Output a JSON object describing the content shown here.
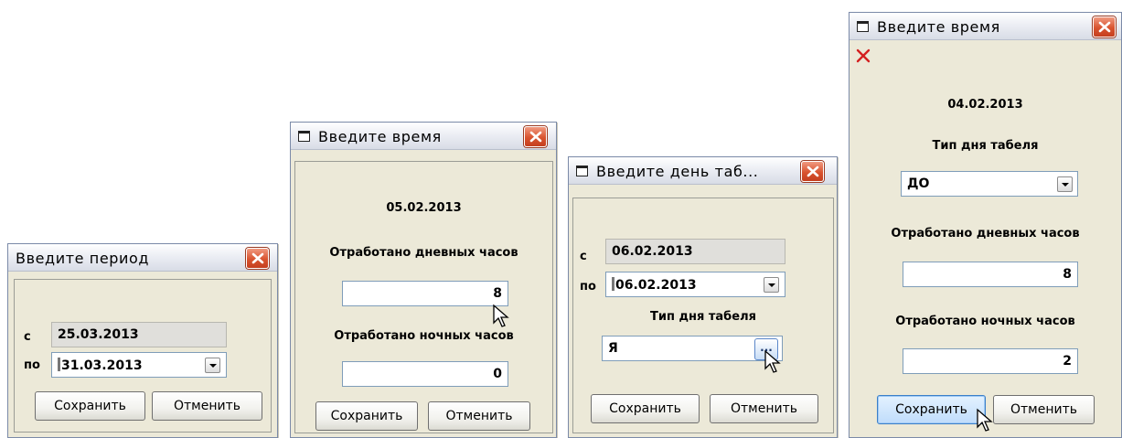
{
  "dialogs": [
    {
      "title": "Введите период",
      "from_label": "с",
      "from_value": "25.03.2013",
      "to_label": "по",
      "to_value": "31.03.2013",
      "save_label": "Сохранить",
      "cancel_label": "Отменить"
    },
    {
      "title": "Введите время",
      "date": "05.02.2013",
      "day_hours_label": "Отработано дневных часов",
      "day_hours_value": "8",
      "night_hours_label": "Отработано ночных часов",
      "night_hours_value": "0",
      "save_label": "Сохранить",
      "cancel_label": "Отменить"
    },
    {
      "title": "Введите день таб...",
      "from_label": "с",
      "from_value": "06.02.2013",
      "to_label": "по",
      "to_value": "06.02.2013",
      "day_type_label": "Тип дня табеля",
      "day_type_value": "Я",
      "ellipsis_label": "...",
      "save_label": "Сохранить",
      "cancel_label": "Отменить"
    },
    {
      "title": "Введите время",
      "date": "04.02.2013",
      "day_type_label": "Тип дня табеля",
      "day_type_value": "ДО",
      "day_hours_label": "Отработано дневных часов",
      "day_hours_value": "8",
      "night_hours_label": "Отработано ночных часов",
      "night_hours_value": "2",
      "save_label": "Сохранить",
      "cancel_label": "Отменить"
    }
  ],
  "icons": {
    "window": "window-icon",
    "close": "close-icon",
    "delete": "red-x-icon",
    "dropdown": "chevron-down-icon",
    "pointer": "mouse-pointer-icon"
  },
  "colors": {
    "dialog_bg": "#ece9d8",
    "close_button": "#d9532f",
    "input_border": "#7f9db9",
    "hover_button": "#bfdcfb"
  }
}
